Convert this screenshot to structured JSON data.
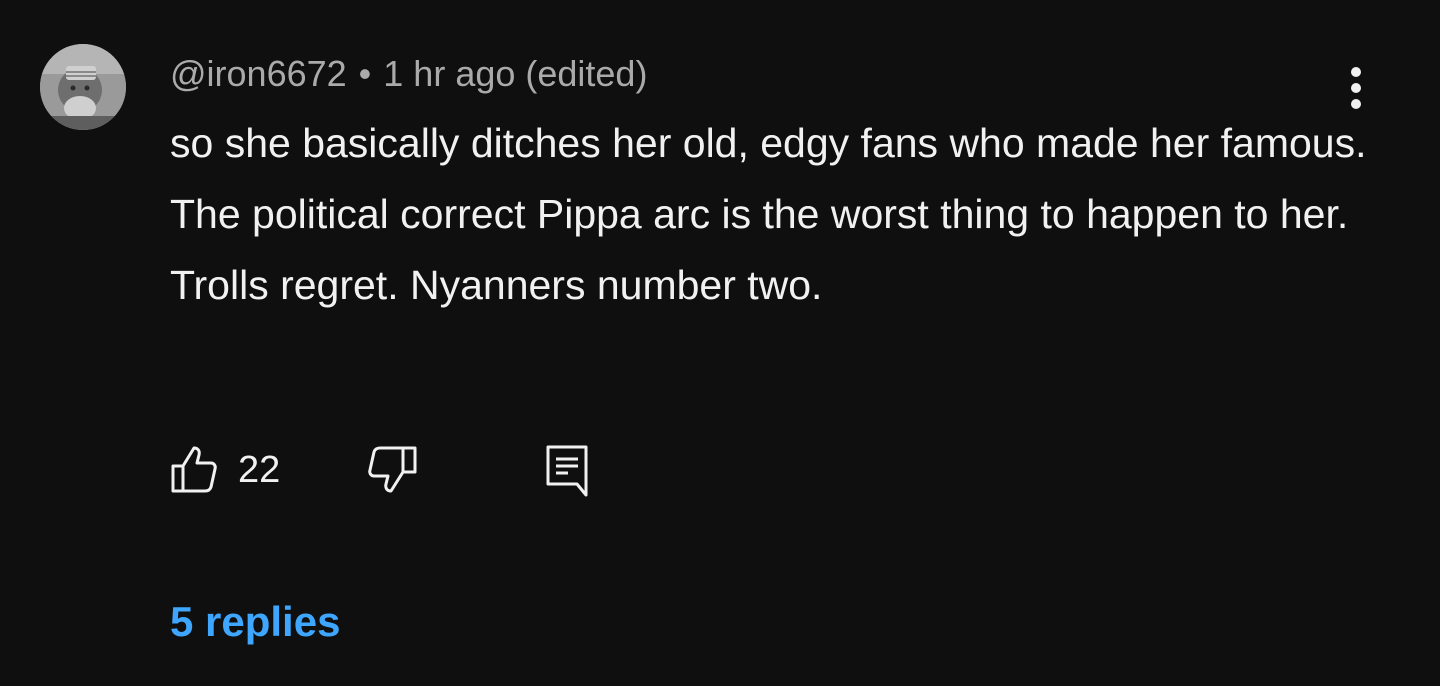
{
  "comment": {
    "author": "@iron6672",
    "separator": "•",
    "timestamp": "1 hr ago (edited)",
    "text": "so she basically ditches her old, edgy fans who made her famous. The political correct Pippa arc is the worst thing to happen to her. Trolls regret. Nyanners number two.",
    "like_count": "22",
    "replies_label": "5 replies"
  },
  "icons": {
    "avatar": "avatar",
    "menu": "more-vert-icon",
    "like": "thumb-up-icon",
    "dislike": "thumb-down-icon",
    "reply": "comment-icon"
  },
  "colors": {
    "background": "#0f0f0f",
    "text": "#f1f1f1",
    "meta": "#aaaaaa",
    "link": "#3ea6ff"
  }
}
